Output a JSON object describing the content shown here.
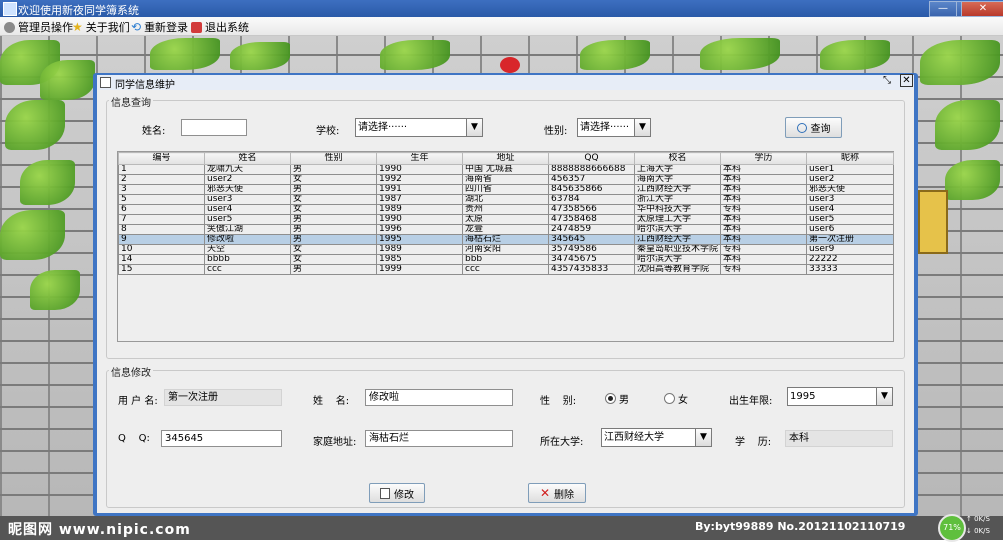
{
  "window": {
    "title": "欢迎使用新夜同学簿系统"
  },
  "menubar": [
    {
      "label": "管理员操作",
      "icon": "gear-icon",
      "color": "#8a8a8a"
    },
    {
      "label": "关于我们",
      "icon": "star-icon",
      "color": "#e3b21c"
    },
    {
      "label": "重新登录",
      "icon": "refresh-icon",
      "color": "#2f7fd2"
    },
    {
      "label": "退出系统",
      "icon": "exit-icon",
      "color": "#d23b3b"
    }
  ],
  "inner": {
    "title": "同学信息维护"
  },
  "query": {
    "group_title": "信息查询",
    "name_label": "姓名:",
    "name_value": "",
    "school_label": "学校:",
    "school_value": "请选择······",
    "gender_label": "性别:",
    "gender_value": "请选择······",
    "search_label": "查询"
  },
  "table": {
    "columns": [
      "编号",
      "姓名",
      "性别",
      "生年",
      "地址",
      "QQ",
      "校名",
      "学历",
      "昵称"
    ],
    "rows": [
      [
        "1",
        "龙啸九天",
        "男",
        "1990",
        "中国 尤城县",
        "8888888666688",
        "上海大学",
        "本科",
        "user1"
      ],
      [
        "2",
        "user2",
        "女",
        "1992",
        "海南省",
        "456357",
        "海南大学",
        "本科",
        "user2"
      ],
      [
        "3",
        "邪恶天使",
        "男",
        "1991",
        "四川省",
        "845635866",
        "江西财经大学",
        "本科",
        "邪恶天使"
      ],
      [
        "5",
        "user3",
        "女",
        "1987",
        "湖北",
        "63784",
        "浙江大学",
        "本科",
        "user3"
      ],
      [
        "6",
        "user4",
        "女",
        "1989",
        "贵州",
        "47358566",
        "华中科技大学",
        "专科",
        "user4"
      ],
      [
        "7",
        "user5",
        "男",
        "1990",
        "太原",
        "47358468",
        "太原理工大学",
        "本科",
        "user5"
      ],
      [
        "8",
        "笑傲江湖",
        "男",
        "1996",
        "龙壹",
        "2474859",
        "哈尔滨大学",
        "本科",
        "user6"
      ],
      [
        "9",
        "修改啦",
        "男",
        "1995",
        "海枯石烂",
        "345645",
        "江西财经大学",
        "本科",
        "第一次注册"
      ],
      [
        "10",
        "天空",
        "女",
        "1989",
        "河南安阳",
        "35749586",
        "秦皇岛职业技术学院",
        "专科",
        "user9"
      ],
      [
        "14",
        "bbbb",
        "女",
        "1985",
        "bbb",
        "34745675",
        "哈尔滨大学",
        "本科",
        "22222"
      ],
      [
        "15",
        "ccc",
        "男",
        "1999",
        "ccc",
        "4357435833",
        "沈阳高等教育学院",
        "专科",
        "33333"
      ]
    ],
    "selected_row": 7
  },
  "edit": {
    "group_title": "信息修改",
    "username_label": "用 户 名:",
    "username_value": "第一次注册",
    "name_label": "姓    名:",
    "name_value": "修改啦",
    "gender_label": "性    别:",
    "male_label": "男",
    "female_label": "女",
    "gender_selected": "男",
    "birth_label": "出生年限:",
    "birth_value": "1995",
    "qq_label": "Q    Q:",
    "qq_value": "345645",
    "address_label": "家庭地址:",
    "address_value": "海枯石烂",
    "university_label": "所在大学:",
    "university_value": "江西财经大学",
    "degree_label": "学    历:",
    "degree_value": "本科",
    "modify_label": "修改",
    "delete_label": "删除"
  },
  "watermark": {
    "left": "昵图网 www.nipic.com",
    "right": "By:byt99889  No.20121102110719"
  },
  "tray": {
    "percent": "71%",
    "up": "0K/S",
    "down": "0K/S"
  }
}
